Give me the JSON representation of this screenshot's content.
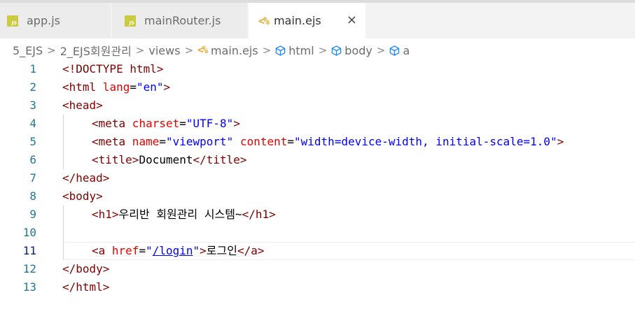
{
  "tabs": [
    {
      "icon": "js-file-icon",
      "icon_text": "JS",
      "label": "app.js"
    },
    {
      "icon": "js-file-icon",
      "icon_text": "JS",
      "label": "mainRouter.js"
    },
    {
      "icon": "ejs-file-icon",
      "icon_text": "<%",
      "label": "main.ejs",
      "active": true
    }
  ],
  "close_icon": "×",
  "breadcrumb": {
    "items": [
      "5_EJS",
      "2_EJS회원관리",
      "views",
      "main.ejs",
      "html",
      "body",
      "a"
    ],
    "ejs_icon": "<%",
    "separator": ">"
  },
  "editor": {
    "current_line": 11,
    "lines": [
      {
        "n": "1",
        "t": [
          "<!DOCTYPE html>"
        ]
      },
      {
        "n": "2",
        "t": [
          "<html",
          " lang",
          "=",
          "\"en\"",
          ">"
        ]
      },
      {
        "n": "3",
        "t": [
          "<head>"
        ]
      },
      {
        "n": "4",
        "t": [
          "<meta",
          " charset",
          "=",
          "\"UTF-8\"",
          ">"
        ]
      },
      {
        "n": "5",
        "t": [
          "<meta",
          " name",
          "=",
          "\"viewport\"",
          " content",
          "=",
          "\"width=device-width, initial-scale=1.0\"",
          ">"
        ]
      },
      {
        "n": "6",
        "t": [
          "<title>",
          "Document",
          "</title>"
        ]
      },
      {
        "n": "7",
        "t": [
          "</head>"
        ]
      },
      {
        "n": "8",
        "t": [
          "<body>"
        ]
      },
      {
        "n": "9",
        "t": [
          "<h1>",
          "우리반 회원관리 시스템~",
          "</h1>"
        ]
      },
      {
        "n": "10",
        "t": []
      },
      {
        "n": "11",
        "t": [
          "<a",
          " href",
          "=",
          "\"",
          "/login",
          "\"",
          ">",
          "로그인",
          "</a>"
        ]
      },
      {
        "n": "12",
        "t": [
          "</body>"
        ]
      },
      {
        "n": "13",
        "t": [
          "</html>"
        ]
      }
    ]
  },
  "colors": {
    "tag": "#800000",
    "attribute": "#e50000",
    "value": "#0000ff",
    "line_number": "#237893",
    "js_icon": "#cbcb41",
    "ejs_icon": "#e5a82e"
  }
}
